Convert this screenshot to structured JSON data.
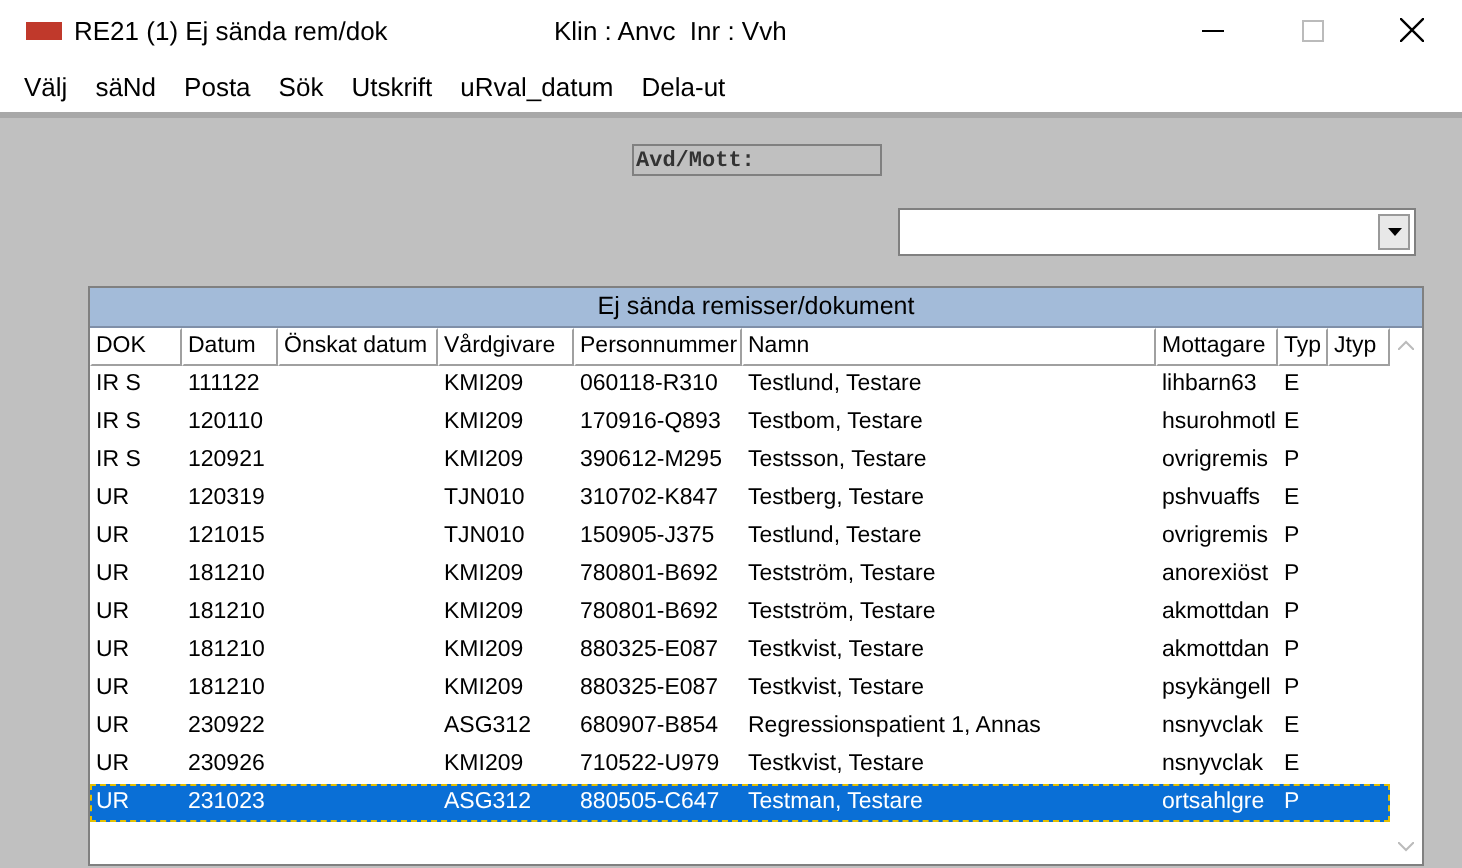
{
  "window": {
    "title": "RE21 (1) Ej sända rem/dok",
    "context": "Klin : Anvc  Inr : Vvh"
  },
  "menu": [
    "Välj",
    "säNd",
    "Posta",
    "Sök",
    "Utskrift",
    "uRval_datum",
    "Dela-ut"
  ],
  "avd_label": "Avd/Mott:",
  "table": {
    "title": "Ej sända remisser/dokument",
    "columns": [
      "DOK",
      "Datum",
      "Önskat datum",
      "Vårdgivare",
      "Personnummer",
      "Namn",
      "Mottagare",
      "Typ",
      "Jtyp"
    ],
    "rows": [
      {
        "dok": "IR S",
        "datum": "111122",
        "vardgivare": "KMI209",
        "personnummer": "060118-R310",
        "namn": "Testlund, Testare",
        "mottagare": "lihbarn63",
        "typ": "E",
        "selected": false
      },
      {
        "dok": "IR S",
        "datum": "120110",
        "vardgivare": "KMI209",
        "personnummer": "170916-Q893",
        "namn": "Testbom, Testare",
        "mottagare": "hsurohmotl",
        "typ": "E",
        "selected": false
      },
      {
        "dok": "IR S",
        "datum": "120921",
        "vardgivare": "KMI209",
        "personnummer": "390612-M295",
        "namn": "Testsson, Testare",
        "mottagare": "ovrigremis",
        "typ": "P",
        "selected": false
      },
      {
        "dok": "UR",
        "datum": "120319",
        "vardgivare": "TJN010",
        "personnummer": "310702-K847",
        "namn": "Testberg, Testare",
        "mottagare": "pshvuaffs",
        "typ": "E",
        "selected": false
      },
      {
        "dok": "UR",
        "datum": "121015",
        "vardgivare": "TJN010",
        "personnummer": "150905-J375",
        "namn": "Testlund, Testare",
        "mottagare": "ovrigremis",
        "typ": "P",
        "selected": false
      },
      {
        "dok": "UR",
        "datum": "181210",
        "vardgivare": "KMI209",
        "personnummer": "780801-B692",
        "namn": "Testström, Testare",
        "mottagare": "anorexiöst",
        "typ": "P",
        "selected": false
      },
      {
        "dok": "UR",
        "datum": "181210",
        "vardgivare": "KMI209",
        "personnummer": "780801-B692",
        "namn": "Testström, Testare",
        "mottagare": "akmottdan",
        "typ": "P",
        "selected": false
      },
      {
        "dok": "UR",
        "datum": "181210",
        "vardgivare": "KMI209",
        "personnummer": "880325-E087",
        "namn": "Testkvist, Testare",
        "mottagare": "akmottdan",
        "typ": "P",
        "selected": false
      },
      {
        "dok": "UR",
        "datum": "181210",
        "vardgivare": "KMI209",
        "personnummer": "880325-E087",
        "namn": "Testkvist, Testare",
        "mottagare": "psykängell",
        "typ": "P",
        "selected": false
      },
      {
        "dok": "UR",
        "datum": "230922",
        "vardgivare": "ASG312",
        "personnummer": "680907-B854",
        "namn": "Regressionspatient 1, Annas",
        "mottagare": "nsnyvclak",
        "typ": "E",
        "selected": false
      },
      {
        "dok": "UR",
        "datum": "230926",
        "vardgivare": "KMI209",
        "personnummer": "710522-U979",
        "namn": "Testkvist, Testare",
        "mottagare": "nsnyvclak",
        "typ": "E",
        "selected": false
      },
      {
        "dok": "UR",
        "datum": "231023",
        "vardgivare": "ASG312",
        "personnummer": "880505-C647",
        "namn": "Testman, Testare",
        "mottagare": "ortsahlgre",
        "typ": "P",
        "selected": true
      }
    ]
  }
}
